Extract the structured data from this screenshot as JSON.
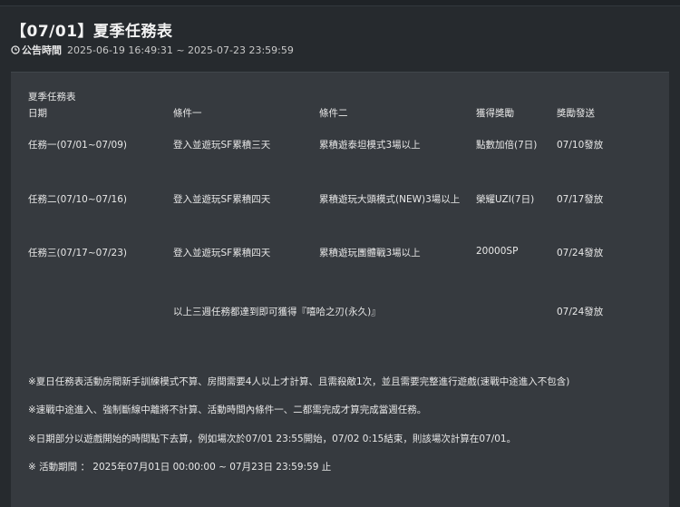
{
  "header": {
    "title": "【07/01】夏季任務表",
    "meta_label": "公告時間",
    "meta_range": "2025-06-19 16:49:31 ~ 2025-07-23 23:59:59"
  },
  "table": {
    "caption": "夏季任務表",
    "headers": [
      "日期",
      "條件一",
      "條件二",
      "獲得獎勵",
      "獎勵發送"
    ],
    "rows": [
      [
        "任務一(07/01~07/09)",
        "登入並遊玩SF累積三天",
        "累積遊泰坦模式3場以上",
        "點數加倍(7日)",
        "07/10發放"
      ],
      [
        "任務二(07/10~07/16)",
        "登入並遊玩SF累積四天",
        "累積遊玩大頭模式(NEW)3場以上",
        "榮耀UZI(7日)",
        "07/17發放"
      ],
      [
        "任務三(07/17~07/23)",
        "登入並遊玩SF累積四天",
        "累積遊玩團體戰3場以上",
        "20000SP",
        "07/24發放"
      ]
    ],
    "summary": "以上三週任務都達到即可獲得『嘻哈之刃(永久)』",
    "summary_send": "07/24發放"
  },
  "notes": [
    "※夏日任務表活動房間新手訓練模式不算、房間需要4人以上才計算、且需殺敵1次，並且需要完整進行遊戲(速戰中途進入不包含)",
    "※速戰中途進入、強制斷線中離將不計算、活動時間內條件一、二都需完成才算完成當週任務。",
    "※日期部分以遊戲開始的時間點下去算，例如場次於07/01 23:55開始，07/02 0:15結束，則該場次計算在07/01。",
    "※  活動期間  ：  2025年07月01日 00:00:00 ~ 07月23日 23:59:59 止"
  ]
}
